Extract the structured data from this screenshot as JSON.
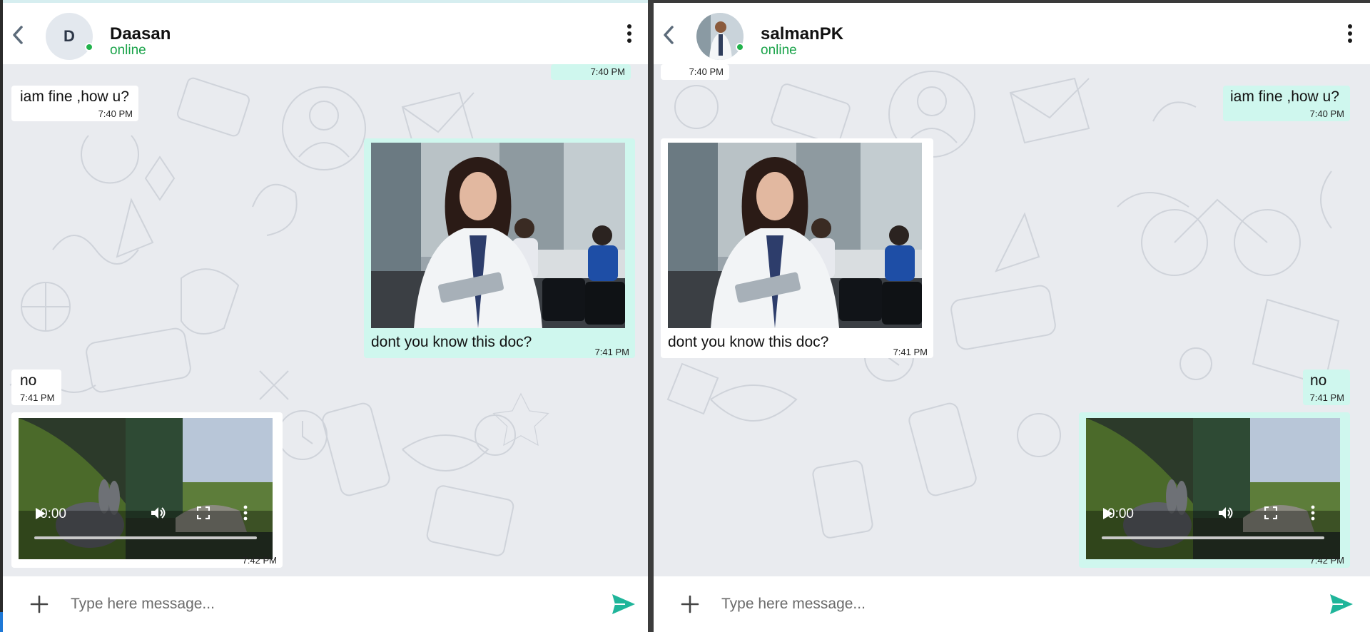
{
  "left_chat": {
    "contact": {
      "initial": "D",
      "name": "Daasan",
      "status": "online"
    },
    "messages": {
      "m0_time": "7:40 PM",
      "m1_text": "iam fine ,how u?",
      "m1_time": "7:40 PM",
      "m2_caption": "dont you know this doc?",
      "m2_time": "7:41 PM",
      "m3_text": "no",
      "m3_time": "7:41 PM",
      "m4_video_time": "0:00",
      "m4_time": "7:42 PM"
    },
    "composer": {
      "placeholder": "Type here message..."
    }
  },
  "right_chat": {
    "contact": {
      "name": "salmanPK",
      "status": "online"
    },
    "messages": {
      "m0_time": "7:40 PM",
      "m1_text": "iam fine ,how u?",
      "m1_time": "7:40 PM",
      "m2_caption": "dont you know this doc?",
      "m2_time": "7:41 PM",
      "m3_text": "no",
      "m3_time": "7:41 PM",
      "m4_video_time": "0:00",
      "m4_time": "7:42 PM"
    },
    "composer": {
      "placeholder": "Type here message..."
    }
  },
  "colors": {
    "incoming_bubble": "#ffffff",
    "outgoing_bubble": "#cff7ee",
    "online_green": "#1aa34a",
    "send_accent": "#1fb59a",
    "chat_background": "#e9ebef"
  },
  "icons": [
    "back-chevron-icon",
    "more-vertical-icon",
    "play-icon",
    "volume-icon",
    "fullscreen-icon",
    "plus-icon",
    "send-icon"
  ]
}
